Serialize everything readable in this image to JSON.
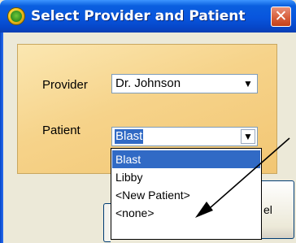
{
  "window": {
    "title": "Select Provider and Patient",
    "app_icon": "app-icon",
    "close_glyph": "✕",
    "close_icon": "close-icon"
  },
  "form": {
    "provider": {
      "label": "Provider",
      "value": "Dr. Johnson",
      "arrow_icon": "chevron-down-icon"
    },
    "patient": {
      "label": "Patient",
      "value": "Blast",
      "arrow_icon": "chevron-down-icon",
      "dropdown_open": true,
      "options": [
        "Blast",
        "Libby",
        "<New Patient>",
        "<none>"
      ],
      "highlighted_option": "Blast"
    }
  },
  "buttons": {
    "cancel_label_visible": "el"
  },
  "annotation": {
    "arrow_icon": "annotation-arrow",
    "arrow_color": "#000000"
  },
  "colors": {
    "titlebar": "#0855dd",
    "panel": "#f6d38a",
    "selection": "#316ac5",
    "close_button": "#d85f3c"
  }
}
